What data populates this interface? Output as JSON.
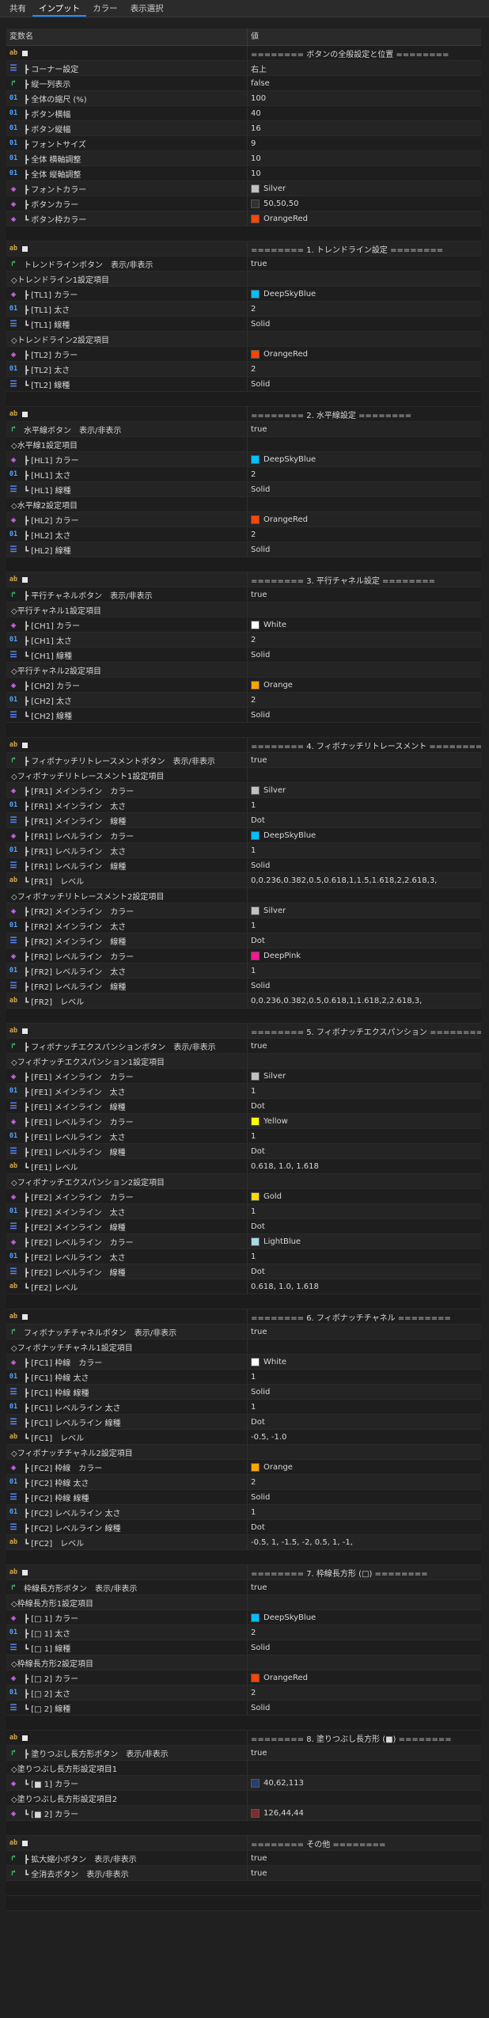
{
  "tabs": [
    "共有",
    "インプット",
    "カラー",
    "表示選択"
  ],
  "header": {
    "name": "変数名",
    "value": "値"
  },
  "colors": {
    "Silver": "#c0c0c0",
    "DeepSkyBlue": "#00bfff",
    "OrangeRed": "#ff4500",
    "White": "#ffffff",
    "Orange": "#ffa500",
    "DeepPink": "#ff1493",
    "Yellow": "#ffff00",
    "Gold": "#ffd700",
    "LightBlue": "#add8e6",
    "50,50,50": "#323232",
    "40,62,113": "#283e71",
    "126,44,44": "#7e2c2c"
  },
  "rows": [
    {
      "t": "ab",
      "n": "",
      "v": "======== ボタンの全般設定と位置 ========",
      "sq": true
    },
    {
      "t": "enum",
      "n": "┣ コーナー設定",
      "v": "右上"
    },
    {
      "t": "bool",
      "n": "┣ 縦一列表示",
      "v": "false"
    },
    {
      "t": "num",
      "n": "┣ 全体の縮尺 (%)",
      "v": "100"
    },
    {
      "t": "num",
      "n": "┣ ボタン横幅",
      "v": "40"
    },
    {
      "t": "num",
      "n": "┣ ボタン縦幅",
      "v": "16"
    },
    {
      "t": "num",
      "n": "┣ フォントサイズ",
      "v": "9"
    },
    {
      "t": "num",
      "n": "┣ 全体 横軸調整",
      "v": "10"
    },
    {
      "t": "num",
      "n": "┣ 全体 縦軸調整",
      "v": "10"
    },
    {
      "t": "color",
      "n": "┣ フォントカラー",
      "v": "Silver",
      "c": true
    },
    {
      "t": "color",
      "n": "┣ ボタンカラー",
      "v": "50,50,50",
      "c": true
    },
    {
      "t": "color",
      "n": "┗ ボタン枠カラー",
      "v": "OrangeRed",
      "c": true
    },
    {
      "t": "blank"
    },
    {
      "t": "ab",
      "n": "",
      "v": "======== 1. トレンドライン設定 ========",
      "sq": true
    },
    {
      "t": "bool",
      "n": "トレンドラインボタン　表示/非表示",
      "v": "true"
    },
    {
      "t": "grp",
      "n": "◇トレンドライン1設定項目",
      "v": ""
    },
    {
      "t": "color",
      "n": "┣ [TL1] カラー",
      "v": "DeepSkyBlue",
      "c": true
    },
    {
      "t": "num",
      "n": "┣ [TL1] 太さ",
      "v": "2"
    },
    {
      "t": "enum",
      "n": "┗ [TL1] 線種",
      "v": "Solid"
    },
    {
      "t": "grp",
      "n": "◇トレンドライン2設定項目",
      "v": ""
    },
    {
      "t": "color",
      "n": "┣ [TL2] カラー",
      "v": "OrangeRed",
      "c": true
    },
    {
      "t": "num",
      "n": "┣ [TL2] 太さ",
      "v": "2"
    },
    {
      "t": "enum",
      "n": "┗ [TL2] 線種",
      "v": "Solid"
    },
    {
      "t": "blank"
    },
    {
      "t": "ab",
      "n": "",
      "v": "======== 2. 水平線設定 ========",
      "sq": true
    },
    {
      "t": "bool",
      "n": "水平線ボタン　表示/非表示",
      "v": "true"
    },
    {
      "t": "grp",
      "n": "◇水平線1設定項目",
      "v": ""
    },
    {
      "t": "color",
      "n": "┣ [HL1] カラー",
      "v": "DeepSkyBlue",
      "c": true
    },
    {
      "t": "num",
      "n": "┣ [HL1] 太さ",
      "v": "2"
    },
    {
      "t": "enum",
      "n": "┗ [HL1] 線種",
      "v": "Solid"
    },
    {
      "t": "grp",
      "n": "◇水平線2設定項目",
      "v": ""
    },
    {
      "t": "color",
      "n": "┣ [HL2] カラー",
      "v": "OrangeRed",
      "c": true
    },
    {
      "t": "num",
      "n": "┣ [HL2] 太さ",
      "v": "2"
    },
    {
      "t": "enum",
      "n": "┗ [HL2] 線種",
      "v": "Solid"
    },
    {
      "t": "blank"
    },
    {
      "t": "ab",
      "n": "",
      "v": "======== 3. 平行チャネル設定 ========",
      "sq": true
    },
    {
      "t": "bool",
      "n": "┣ 平行チャネルボタン　表示/非表示",
      "v": "true"
    },
    {
      "t": "grp",
      "n": "◇平行チャネル1設定項目",
      "v": ""
    },
    {
      "t": "color",
      "n": "┣ [CH1] カラー",
      "v": "White",
      "c": true
    },
    {
      "t": "num",
      "n": "┣ [CH1] 太さ",
      "v": "2"
    },
    {
      "t": "enum",
      "n": "┗ [CH1] 線種",
      "v": "Solid"
    },
    {
      "t": "grp",
      "n": "◇平行チャネル2設定項目",
      "v": ""
    },
    {
      "t": "color",
      "n": "┣ [CH2] カラー",
      "v": "Orange",
      "c": true
    },
    {
      "t": "num",
      "n": "┣ [CH2] 太さ",
      "v": "2"
    },
    {
      "t": "enum",
      "n": "┗ [CH2] 線種",
      "v": "Solid"
    },
    {
      "t": "blank"
    },
    {
      "t": "ab",
      "n": "",
      "v": "======== 4. フィボナッチリトレースメント ========",
      "sq": true
    },
    {
      "t": "bool",
      "n": "┣ フィボナッチリトレースメントボタン　表示/非表示",
      "v": "true"
    },
    {
      "t": "grp",
      "n": "◇フィボナッチリトレースメント1設定項目",
      "v": ""
    },
    {
      "t": "color",
      "n": "┣ [FR1] メインライン　カラー",
      "v": "Silver",
      "c": true
    },
    {
      "t": "num",
      "n": "┣ [FR1] メインライン　太さ",
      "v": "1"
    },
    {
      "t": "enum",
      "n": "┣ [FR1] メインライン　線種",
      "v": "Dot"
    },
    {
      "t": "color",
      "n": "┣ [FR1] レベルライン　カラー",
      "v": "DeepSkyBlue",
      "c": true
    },
    {
      "t": "num",
      "n": "┣ [FR1] レベルライン　太さ",
      "v": "1"
    },
    {
      "t": "enum",
      "n": "┣ [FR1] レベルライン　線種",
      "v": "Solid"
    },
    {
      "t": "ab",
      "n": "┗ [FR1]　レベル",
      "v": "0,0.236,0.382,0.5,0.618,1,1.5,1.618,2,2.618,3,"
    },
    {
      "t": "grp",
      "n": "◇フィボナッチリトレースメント2設定項目",
      "v": ""
    },
    {
      "t": "color",
      "n": "┣ [FR2] メインライン　カラー",
      "v": "Silver",
      "c": true
    },
    {
      "t": "num",
      "n": "┣ [FR2] メインライン　太さ",
      "v": "1"
    },
    {
      "t": "enum",
      "n": "┣ [FR2] メインライン　線種",
      "v": "Dot"
    },
    {
      "t": "color",
      "n": "┣ [FR2] レベルライン　カラー",
      "v": "DeepPink",
      "c": true
    },
    {
      "t": "num",
      "n": "┣ [FR2] レベルライン　太さ",
      "v": "1"
    },
    {
      "t": "enum",
      "n": "┣ [FR2] レベルライン　線種",
      "v": "Solid"
    },
    {
      "t": "ab",
      "n": "┗ [FR2]　レベル",
      "v": "0,0.236,0.382,0.5,0.618,1,1.618,2,2.618,3,"
    },
    {
      "t": "blank"
    },
    {
      "t": "ab",
      "n": "",
      "v": "======== 5. フィボナッチエクスパンション ========",
      "sq": true
    },
    {
      "t": "bool",
      "n": "┣ フィボナッチエクスパンションボタン　表示/非表示",
      "v": "true"
    },
    {
      "t": "grp",
      "n": "◇フィボナッチエクスパンション1設定項目",
      "v": ""
    },
    {
      "t": "color",
      "n": "┣ [FE1] メインライン　カラー",
      "v": "Silver",
      "c": true
    },
    {
      "t": "num",
      "n": "┣ [FE1] メインライン　太さ",
      "v": "1"
    },
    {
      "t": "enum",
      "n": "┣ [FE1] メインライン　線種",
      "v": "Dot"
    },
    {
      "t": "color",
      "n": "┣ [FE1] レベルライン　カラー",
      "v": "Yellow",
      "c": true
    },
    {
      "t": "num",
      "n": "┣ [FE1] レベルライン　太さ",
      "v": "1"
    },
    {
      "t": "enum",
      "n": "┣ [FE1] レベルライン　線種",
      "v": "Dot"
    },
    {
      "t": "ab",
      "n": "┗ [FE1] レベル",
      "v": "0.618, 1.0, 1.618"
    },
    {
      "t": "grp",
      "n": "◇フィボナッチエクスパンション2設定項目",
      "v": ""
    },
    {
      "t": "color",
      "n": "┣ [FE2] メインライン　カラー",
      "v": "Gold",
      "c": true
    },
    {
      "t": "num",
      "n": "┣ [FE2] メインライン　太さ",
      "v": "1"
    },
    {
      "t": "enum",
      "n": "┣ [FE2] メインライン　線種",
      "v": "Dot"
    },
    {
      "t": "color",
      "n": "┣ [FE2] レベルライン　カラー",
      "v": "LightBlue",
      "c": true
    },
    {
      "t": "num",
      "n": "┣ [FE2] レベルライン　太さ",
      "v": "1"
    },
    {
      "t": "enum",
      "n": "┣ [FE2] レベルライン　線種",
      "v": "Dot"
    },
    {
      "t": "ab",
      "n": "┗ [FE2] レベル",
      "v": "0.618, 1.0, 1.618"
    },
    {
      "t": "blank"
    },
    {
      "t": "ab",
      "n": "",
      "v": "======== 6. フィボナッチチャネル ========",
      "sq": true
    },
    {
      "t": "bool",
      "n": "フィボナッチチャネルボタン　表示/非表示",
      "v": "true"
    },
    {
      "t": "grp",
      "n": "◇フィボナッチチャネル1設定項目",
      "v": ""
    },
    {
      "t": "color",
      "n": "┣ [FC1] 枠線　カラー",
      "v": "White",
      "c": true
    },
    {
      "t": "num",
      "n": "┣ [FC1] 枠線 太さ",
      "v": "1"
    },
    {
      "t": "enum",
      "n": "┣ [FC1] 枠線 線種",
      "v": "Solid"
    },
    {
      "t": "num",
      "n": "┣ [FC1] レベルライン 太さ",
      "v": "1"
    },
    {
      "t": "enum",
      "n": "┣ [FC1] レベルライン 線種",
      "v": "Dot"
    },
    {
      "t": "ab",
      "n": "┗ [FC1]　レベル",
      "v": "-0.5, -1.0"
    },
    {
      "t": "grp",
      "n": "◇フィボナッチチャネル2設定項目",
      "v": ""
    },
    {
      "t": "color",
      "n": "┣ [FC2] 枠線　カラー",
      "v": "Orange",
      "c": true
    },
    {
      "t": "num",
      "n": "┣ [FC2] 枠線 太さ",
      "v": "2"
    },
    {
      "t": "enum",
      "n": "┣ [FC2] 枠線 線種",
      "v": "Solid"
    },
    {
      "t": "num",
      "n": "┣ [FC2] レベルライン 太さ",
      "v": "1"
    },
    {
      "t": "enum",
      "n": "┣ [FC2] レベルライン 線種",
      "v": "Dot"
    },
    {
      "t": "ab",
      "n": "┗ [FC2]　レベル",
      "v": "-0.5, 1, -1.5, -2, 0.5, 1, -1,"
    },
    {
      "t": "blank"
    },
    {
      "t": "ab",
      "n": "",
      "v": "======== 7. 枠線長方形 (□) ========",
      "sq": true
    },
    {
      "t": "bool",
      "n": "枠線長方形ボタン　表示/非表示",
      "v": "true"
    },
    {
      "t": "grp",
      "n": "◇枠線長方形1設定項目",
      "v": ""
    },
    {
      "t": "color",
      "n": "┣ [□ 1] カラー",
      "v": "DeepSkyBlue",
      "c": true
    },
    {
      "t": "num",
      "n": "┣ [□ 1] 太さ",
      "v": "2"
    },
    {
      "t": "enum",
      "n": "┗ [□ 1] 線種",
      "v": "Solid"
    },
    {
      "t": "grp",
      "n": "◇枠線長方形2設定項目",
      "v": ""
    },
    {
      "t": "color",
      "n": "┣ [□ 2] カラー",
      "v": "OrangeRed",
      "c": true
    },
    {
      "t": "num",
      "n": "┣ [□ 2] 太さ",
      "v": "2"
    },
    {
      "t": "enum",
      "n": "┗ [□ 2] 線種",
      "v": "Solid"
    },
    {
      "t": "blank"
    },
    {
      "t": "ab",
      "n": "",
      "v": "======== 8. 塗りつぶし長方形 (■) ========",
      "sq": true
    },
    {
      "t": "bool",
      "n": "┣ 塗りつぶし長方形ボタン　表示/非表示",
      "v": "true"
    },
    {
      "t": "grp",
      "n": "◇塗りつぶし長方形設定項目1",
      "v": ""
    },
    {
      "t": "color",
      "n": "┗ [■ 1] カラー",
      "v": "40,62,113",
      "c": true
    },
    {
      "t": "grp",
      "n": "◇塗りつぶし長方形設定項目2",
      "v": ""
    },
    {
      "t": "color",
      "n": "┗ [■ 2] カラー",
      "v": "126,44,44",
      "c": true
    },
    {
      "t": "blank"
    },
    {
      "t": "ab",
      "n": "",
      "v": "======== その他 ========",
      "sq": true
    },
    {
      "t": "bool",
      "n": "┣ 拡大縮小ボタン　表示/非表示",
      "v": "true"
    },
    {
      "t": "bool",
      "n": "┗ 全消去ボタン　表示/非表示",
      "v": "true"
    },
    {
      "t": "blank"
    },
    {
      "t": "blank"
    }
  ]
}
